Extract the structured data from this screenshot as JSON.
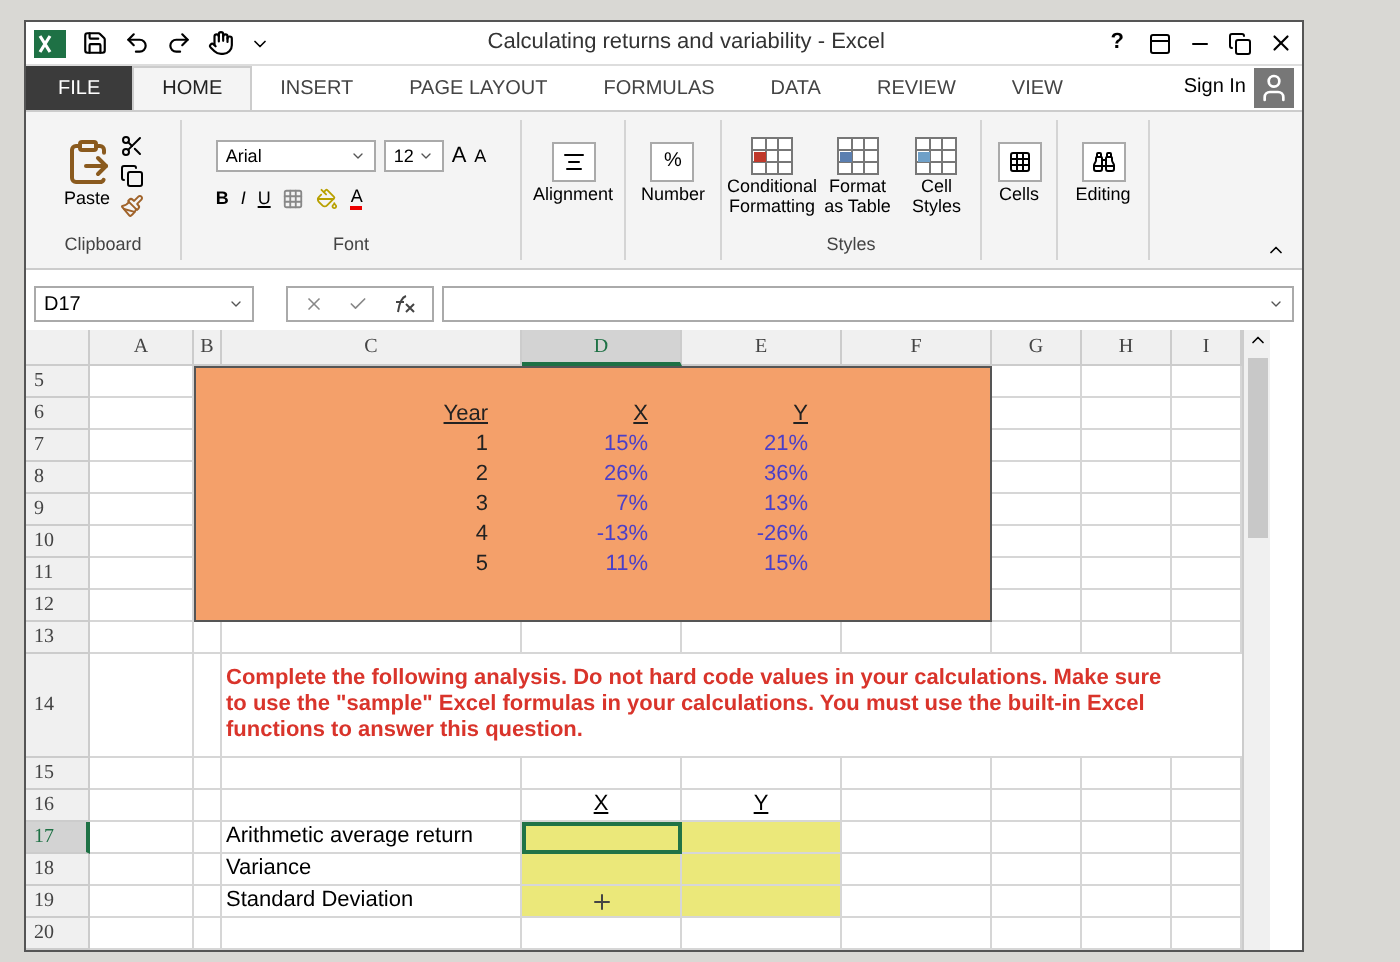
{
  "window": {
    "title": "Calculating returns and variability - Excel",
    "help": "?"
  },
  "tabs": [
    {
      "label": "FILE",
      "kind": "file",
      "selected": false
    },
    {
      "label": "HOME",
      "kind": "tab",
      "selected": true
    },
    {
      "label": "INSERT",
      "kind": "tab",
      "selected": false
    },
    {
      "label": "PAGE LAYOUT",
      "kind": "tab",
      "selected": false
    },
    {
      "label": "FORMULAS",
      "kind": "tab",
      "selected": false
    },
    {
      "label": "DATA",
      "kind": "tab",
      "selected": false
    },
    {
      "label": "REVIEW",
      "kind": "tab",
      "selected": false
    },
    {
      "label": "VIEW",
      "kind": "tab",
      "selected": false
    }
  ],
  "sign_in": "Sign In",
  "ribbon": {
    "clipboard": {
      "paste": "Paste",
      "label": "Clipboard"
    },
    "font": {
      "name": "Arial",
      "size": "12",
      "grow": "A",
      "shrink": "A",
      "bold": "B",
      "italic": "I",
      "underline": "U",
      "text_color_button": "A",
      "label": "Font"
    },
    "alignment": "Alignment",
    "number": {
      "symbol": "%",
      "label": "Number"
    },
    "styles": {
      "buttons": [
        "Conditional Formatting",
        "Format as Table",
        "Cell Styles"
      ],
      "label": "Styles"
    },
    "cells": "Cells",
    "editing": "Editing"
  },
  "name_box": "D17",
  "columns": [
    {
      "label": "A",
      "selected": false
    },
    {
      "label": "B",
      "selected": false
    },
    {
      "label": "C",
      "selected": false
    },
    {
      "label": "D",
      "selected": true
    },
    {
      "label": "E",
      "selected": false
    },
    {
      "label": "F",
      "selected": false
    },
    {
      "label": "G",
      "selected": false
    },
    {
      "label": "H",
      "selected": false
    },
    {
      "label": "I",
      "selected": false
    }
  ],
  "rows": [
    {
      "label": "5",
      "selected": false
    },
    {
      "label": "6",
      "selected": false
    },
    {
      "label": "7",
      "selected": false
    },
    {
      "label": "8",
      "selected": false
    },
    {
      "label": "9",
      "selected": false
    },
    {
      "label": "10",
      "selected": false
    },
    {
      "label": "11",
      "selected": false
    },
    {
      "label": "12",
      "selected": false
    },
    {
      "label": "13",
      "selected": false
    },
    {
      "label": "14",
      "selected": false
    },
    {
      "label": "15",
      "selected": false
    },
    {
      "label": "16",
      "selected": false
    },
    {
      "label": "17",
      "selected": true
    },
    {
      "label": "18",
      "selected": false
    },
    {
      "label": "19",
      "selected": false
    },
    {
      "label": "20",
      "selected": false
    }
  ],
  "returns_table": {
    "headers": [
      "Year",
      "X",
      "Y"
    ],
    "rows": [
      [
        "1",
        "15%",
        "21%"
      ],
      [
        "2",
        "26%",
        "36%"
      ],
      [
        "3",
        "7%",
        "13%"
      ],
      [
        "4",
        "-13%",
        "-26%"
      ],
      [
        "5",
        "11%",
        "15%"
      ]
    ]
  },
  "instructions": "Complete the following analysis. Do not hard code values in your calculations. Make sure to use the \"sample\" Excel formulas in your calculations. You must use the built-in Excel functions to answer this question.",
  "analysis": {
    "headers": [
      "X",
      "Y"
    ],
    "labels": [
      "Arithmetic average return",
      "Variance",
      "Standard Deviation"
    ]
  }
}
